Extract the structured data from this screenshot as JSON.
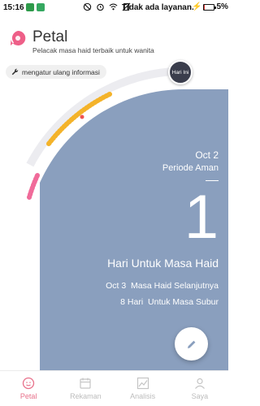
{
  "status_bar": {
    "time": "15:16",
    "carrier": "Tidak ada layanan.",
    "battery": "5%",
    "battery_level_percent": 5,
    "icons": [
      "shield-icon",
      "s-badge-icon",
      "mute-icon",
      "alarm-icon",
      "wifi-icon",
      "no-sim-icon",
      "charging-icon"
    ]
  },
  "header": {
    "app_name": "Petal",
    "tagline": "Pelacak masa haid terbaik untuk wanita"
  },
  "reset_button": {
    "label": "mengatur ulang informasi"
  },
  "cycle": {
    "today_marker": "Hari Ini"
  },
  "summary": {
    "date": "Oct 2",
    "phase": "Periode Aman",
    "count": "1",
    "count_label": "Hari Untuk Masa Haid",
    "next_date": "Oct 3",
    "next_label": "Masa Haid Selanjutnya",
    "fertile_days": "8 Hari",
    "fertile_label": "Untuk Masa Subur"
  },
  "nav": {
    "items": [
      {
        "label": "Petal",
        "icon": "petal-face-icon",
        "active": true
      },
      {
        "label": "Rekaman",
        "icon": "calendar-icon",
        "active": false
      },
      {
        "label": "Analisis",
        "icon": "chart-icon",
        "active": false
      },
      {
        "label": "Saya",
        "icon": "profile-icon",
        "active": false
      }
    ]
  },
  "colors": {
    "accent_pink": "#e8708a",
    "period_pink": "#f06b9a",
    "fertile_orange": "#f4b32a",
    "background_blue": "#8a9fbe",
    "track_gray": "#ececf0"
  }
}
